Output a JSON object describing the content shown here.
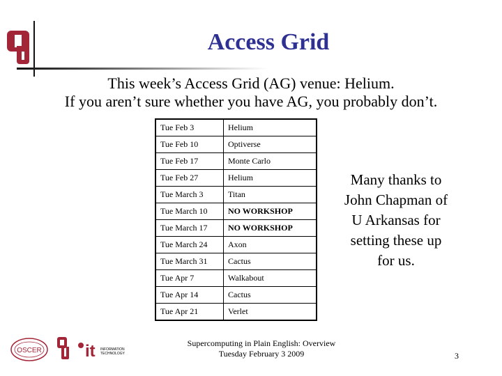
{
  "header": {
    "title": "Access Grid",
    "title_color": "#2e3192",
    "logo": "ou-logo-icon"
  },
  "intro": {
    "line1": "This week’s Access Grid (AG) venue: Helium.",
    "line2": "If you aren’t sure whether you have AG, you probably don’t."
  },
  "schedule": {
    "rows": [
      {
        "date": "Tue Feb 3",
        "venue": "Helium",
        "bold": false
      },
      {
        "date": "Tue Feb 10",
        "venue": "Optiverse",
        "bold": false
      },
      {
        "date": "Tue Feb 17",
        "venue": "Monte Carlo",
        "bold": false
      },
      {
        "date": "Tue Feb 27",
        "venue": "Helium",
        "bold": false
      },
      {
        "date": "Tue March 3",
        "venue": "Titan",
        "bold": false
      },
      {
        "date": "Tue March 10",
        "venue": "NO WORKSHOP",
        "bold": true
      },
      {
        "date": "Tue March 17",
        "venue": "NO WORKSHOP",
        "bold": true
      },
      {
        "date": "Tue March 24",
        "venue": "Axon",
        "bold": false
      },
      {
        "date": "Tue March 31",
        "venue": "Cactus",
        "bold": false
      },
      {
        "date": "Tue Apr 7",
        "venue": "Walkabout",
        "bold": false
      },
      {
        "date": "Tue Apr 14",
        "venue": "Cactus",
        "bold": false
      },
      {
        "date": "Tue Apr 21",
        "venue": "Verlet",
        "bold": false
      }
    ]
  },
  "thanks": {
    "lines": [
      "Many thanks to",
      "John Chapman of",
      "U Arkansas for",
      "setting these up",
      "for us."
    ]
  },
  "footer": {
    "line1": "Supercomputing in Plain English: Overview",
    "line2": "Tuesday February 3 2009",
    "page_number": "3",
    "logos": {
      "oscer": "OSCER",
      "it_label": "it",
      "it_text1": "INFORMATION",
      "it_text2": "TECHNOLOGY"
    }
  }
}
